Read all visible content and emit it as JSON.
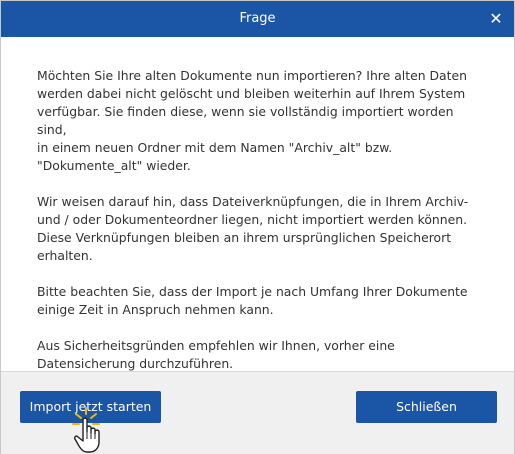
{
  "window": {
    "title": "Frage",
    "close_glyph": "✕"
  },
  "content": {
    "paragraphs": [
      "Möchten Sie Ihre alten Dokumente nun importieren? Ihre alten Daten\nwerden dabei nicht gelöscht und bleiben weiterhin auf Ihrem System\nverfügbar. Sie finden diese, wenn sie vollständig importiert worden sind,\nin einem neuen Ordner mit dem Namen \"Archiv_alt\" bzw.\n\"Dokumente_alt\" wieder.",
      "Wir weisen darauf hin, dass Dateiverknüpfungen, die in Ihrem Archiv-\nund / oder Dokumenteordner liegen, nicht importiert werden können.\nDiese Verknüpfungen bleiben an ihrem ursprünglichen Speicherort\nerhalten.",
      "Bitte beachten Sie, dass der Import je nach Umfang Ihrer Dokumente\neinige Zeit in Anspruch nehmen kann.",
      "Aus Sicherheitsgründen empfehlen wir Ihnen, vorher eine\nDatensicherung durchzuführen."
    ]
  },
  "buttons": {
    "import_label": "Import jetzt starten",
    "close_label": "Schließen"
  },
  "icons": {
    "cursor": "hand-pointer-icon"
  },
  "colors": {
    "accent": "#1b56a6",
    "footer_bg": "#f0f0f0",
    "text": "#333333"
  }
}
